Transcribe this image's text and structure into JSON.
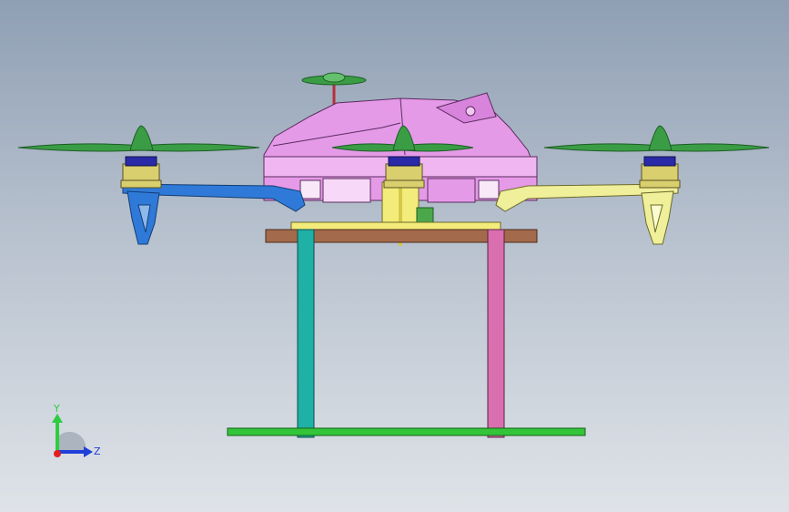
{
  "viewport": {
    "background_top": "#8f9fb4",
    "background_bottom": "#dfe3e8"
  },
  "model": {
    "description_icon": "quadcopter-model-side-view",
    "colors": {
      "canopy": "#e59ae8",
      "canopy_light": "#f3c8f3",
      "arm_left": "#2f7ad8",
      "arm_right": "#f0ef9a",
      "motor_gold": "#d9cf6e",
      "motor_blue": "#2a2aa8",
      "propeller": "#3a9d45",
      "leg_left": "#1fb0a6",
      "leg_right": "#d96fae",
      "plate": "#a36a4b",
      "skid": "#33c43a",
      "mount": "#f3ec7a"
    }
  },
  "triad": {
    "y_label": "Y",
    "z_label": "Z",
    "y_color": "#2ecc40",
    "z_color": "#1f3fd8",
    "origin_color": "#e02020"
  }
}
